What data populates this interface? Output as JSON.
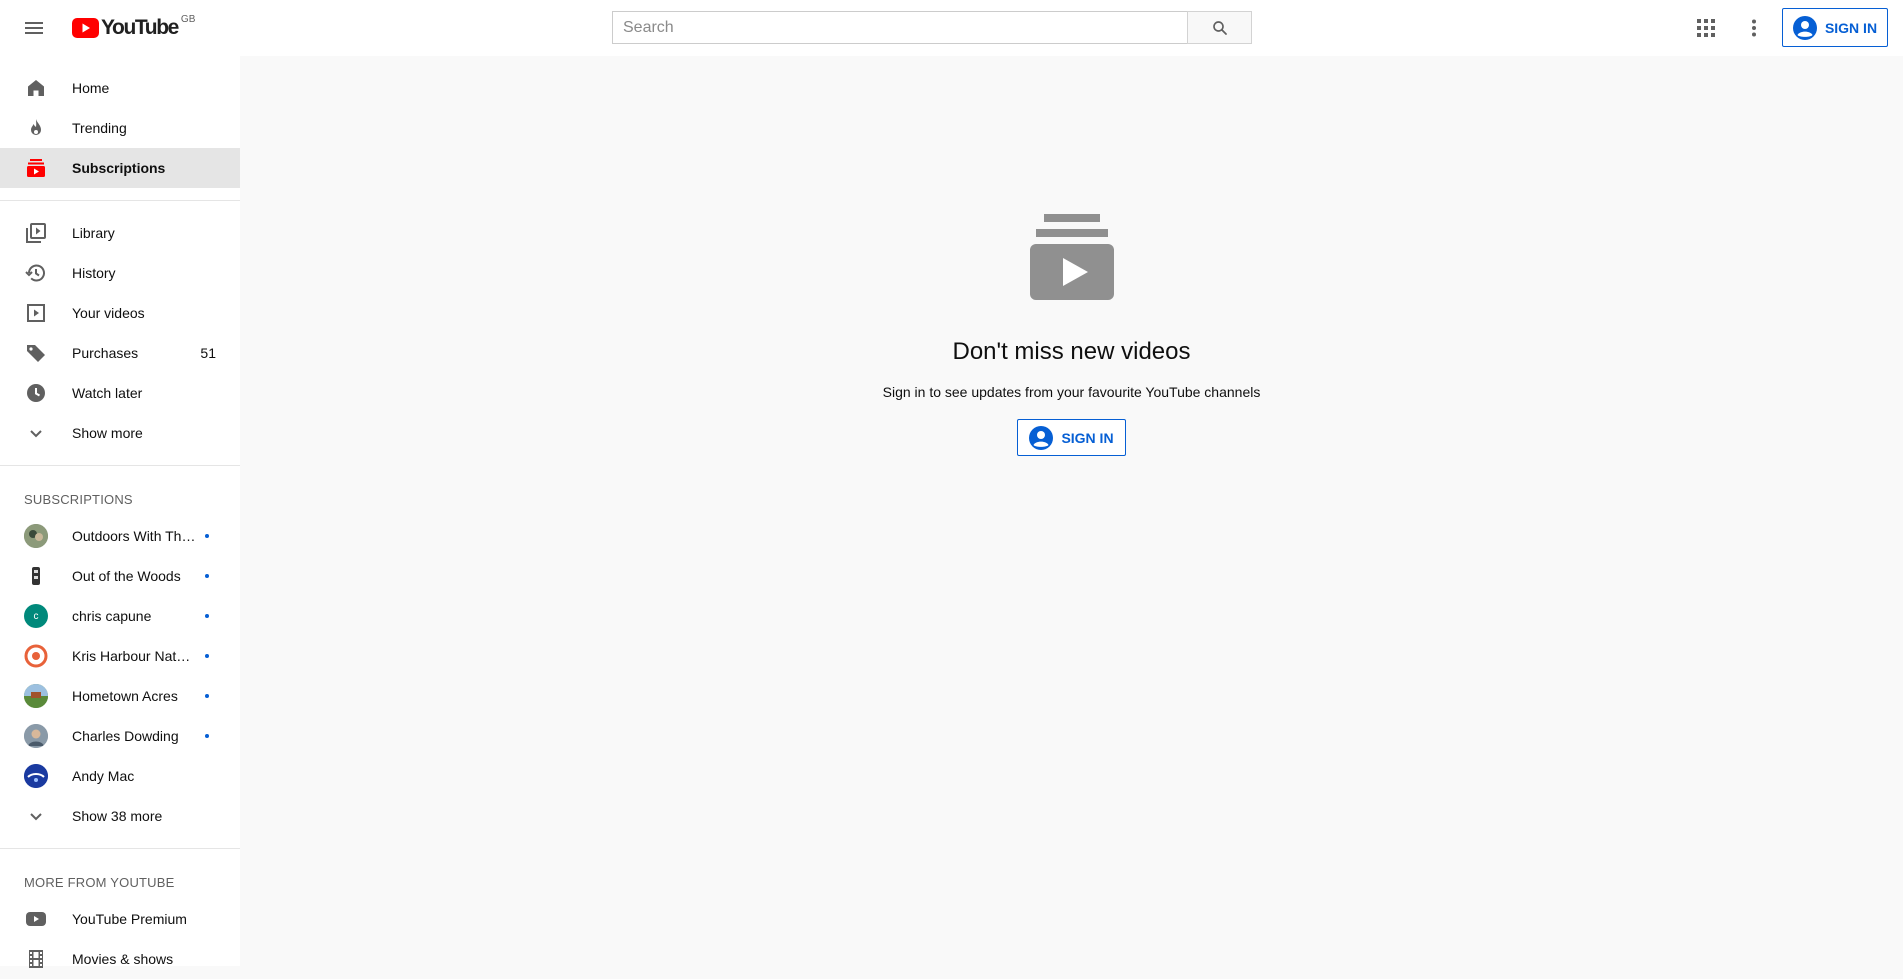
{
  "header": {
    "logo_text": "YouTube",
    "logo_region": "GB",
    "search_placeholder": "Search",
    "signin_label": "SIGN IN"
  },
  "sidebar": {
    "primary": [
      {
        "label": "Home",
        "icon": "home-icon"
      },
      {
        "label": "Trending",
        "icon": "flame-icon"
      },
      {
        "label": "Subscriptions",
        "icon": "subscriptions-icon",
        "active": true
      }
    ],
    "library": [
      {
        "label": "Library",
        "icon": "library-icon"
      },
      {
        "label": "History",
        "icon": "history-icon"
      },
      {
        "label": "Your videos",
        "icon": "your-videos-icon"
      },
      {
        "label": "Purchases",
        "icon": "tag-icon",
        "count": "51"
      },
      {
        "label": "Watch later",
        "icon": "clock-icon"
      },
      {
        "label": "Show more",
        "icon": "chevron-down-icon"
      }
    ],
    "subscriptions_title": "SUBSCRIPTIONS",
    "subscriptions": [
      {
        "label": "Outdoors With The...",
        "avatar_color": "#6b7a5a"
      },
      {
        "label": "Out of the Woods",
        "avatar_color": "#ffffff"
      },
      {
        "label": "chris capune",
        "avatar_color": "#00897b",
        "avatar_letter": "c"
      },
      {
        "label": "Kris Harbour Natur...",
        "avatar_color": "#e8623a"
      },
      {
        "label": "Hometown Acres",
        "avatar_color": "#5a8a3a"
      },
      {
        "label": "Charles Dowding",
        "avatar_color": "#7a8a9a"
      },
      {
        "label": "Andy Mac",
        "avatar_color": "#1a3aa0"
      }
    ],
    "show_more_subs": "Show 38 more",
    "more_title": "MORE FROM YOUTUBE",
    "more": [
      {
        "label": "YouTube Premium",
        "icon": "youtube-premium-icon"
      },
      {
        "label": "Movies & shows",
        "icon": "film-icon"
      }
    ]
  },
  "main": {
    "empty_title": "Don't miss new videos",
    "empty_subtitle": "Sign in to see updates from your favourite YouTube channels",
    "signin_label": "SIGN IN"
  },
  "colors": {
    "brand_red": "#ff0000",
    "accent_blue": "#065fd4",
    "icon_grey": "#606060"
  }
}
